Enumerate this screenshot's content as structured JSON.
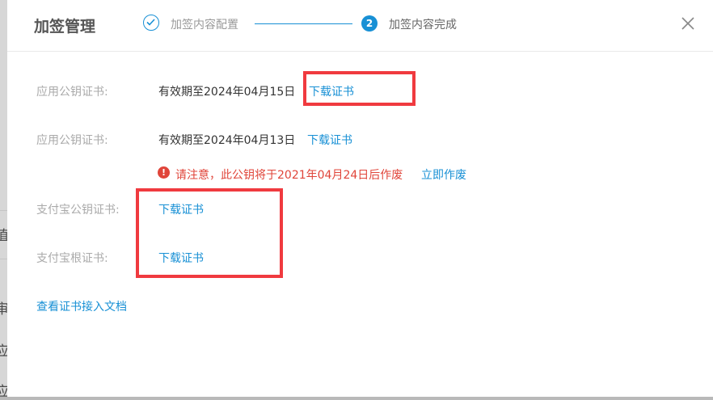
{
  "backdrop": {
    "chars": [
      "值",
      "审",
      "应",
      "应"
    ]
  },
  "modal": {
    "title": "加签管理",
    "steps": [
      {
        "label": "加签内容配置",
        "status": "done"
      },
      {
        "number": "2",
        "label": "加签内容完成",
        "status": "active"
      }
    ]
  },
  "rows": {
    "app_cert_1": {
      "label": "应用公钥证书:",
      "validity": "有效期至2024年04月15日",
      "link": "下载证书"
    },
    "app_cert_2": {
      "label": "应用公钥证书:",
      "validity": "有效期至2024年04月13日",
      "link": "下载证书"
    },
    "warning": {
      "text": "请注意，此公钥将于2021年04月24日后作废",
      "action": "立即作废"
    },
    "alipay_public_cert": {
      "label": "支付宝公钥证书:",
      "link": "下载证书"
    },
    "alipay_root_cert": {
      "label": "支付宝根证书:",
      "link": "下载证书"
    },
    "doc_link": "查看证书接入文档"
  },
  "colors": {
    "accent": "#1890d5",
    "warning": "#e0453a",
    "highlight": "#f03a3f"
  }
}
